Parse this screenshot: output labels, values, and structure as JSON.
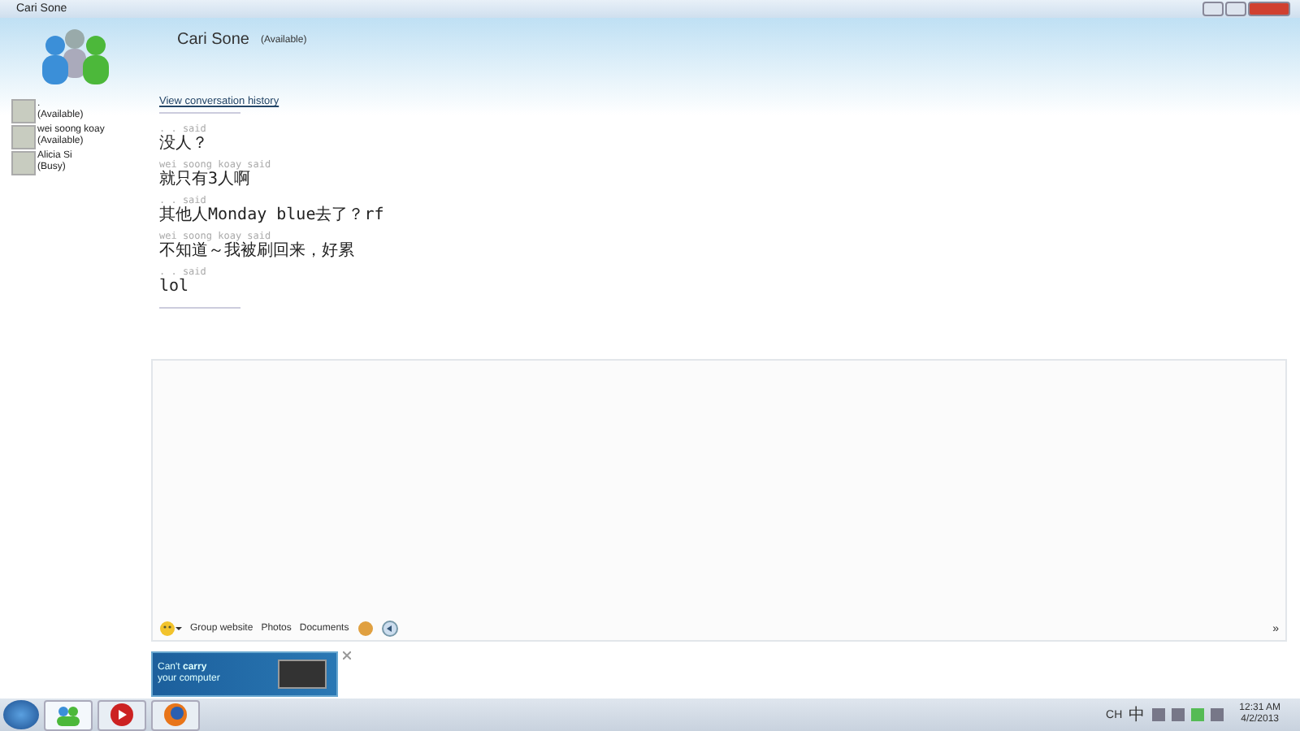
{
  "window": {
    "title": "Cari Sone"
  },
  "header": {
    "name": "Cari Sone",
    "status": "(Available)"
  },
  "contacts": [
    {
      "name": ".",
      "status": "(Available)"
    },
    {
      "name": "wei soong koay",
      "status": "(Available)"
    },
    {
      "name": "Alicia Si",
      "status": "(Busy)"
    }
  ],
  "history_link": "View conversation history",
  "messages": [
    {
      "sender": ". . said",
      "text": "没人？"
    },
    {
      "sender": "wei soong koay said",
      "text": "就只有3人啊"
    },
    {
      "sender": ". . said",
      "text": "其他人Monday blue去了？rf"
    },
    {
      "sender": "wei soong koay said",
      "text": "不知道～我被刷回来，好累"
    },
    {
      "sender": ". . said",
      "text": "lol"
    }
  ],
  "toolbar": {
    "links": [
      "Group website",
      "Photos",
      "Documents"
    ],
    "more": "»"
  },
  "ad": {
    "text": "Can't **carry** your computer"
  },
  "taskbar": {
    "language": "CH",
    "ime": "中",
    "time": "12:31 AM",
    "date": "4/2/2013"
  }
}
